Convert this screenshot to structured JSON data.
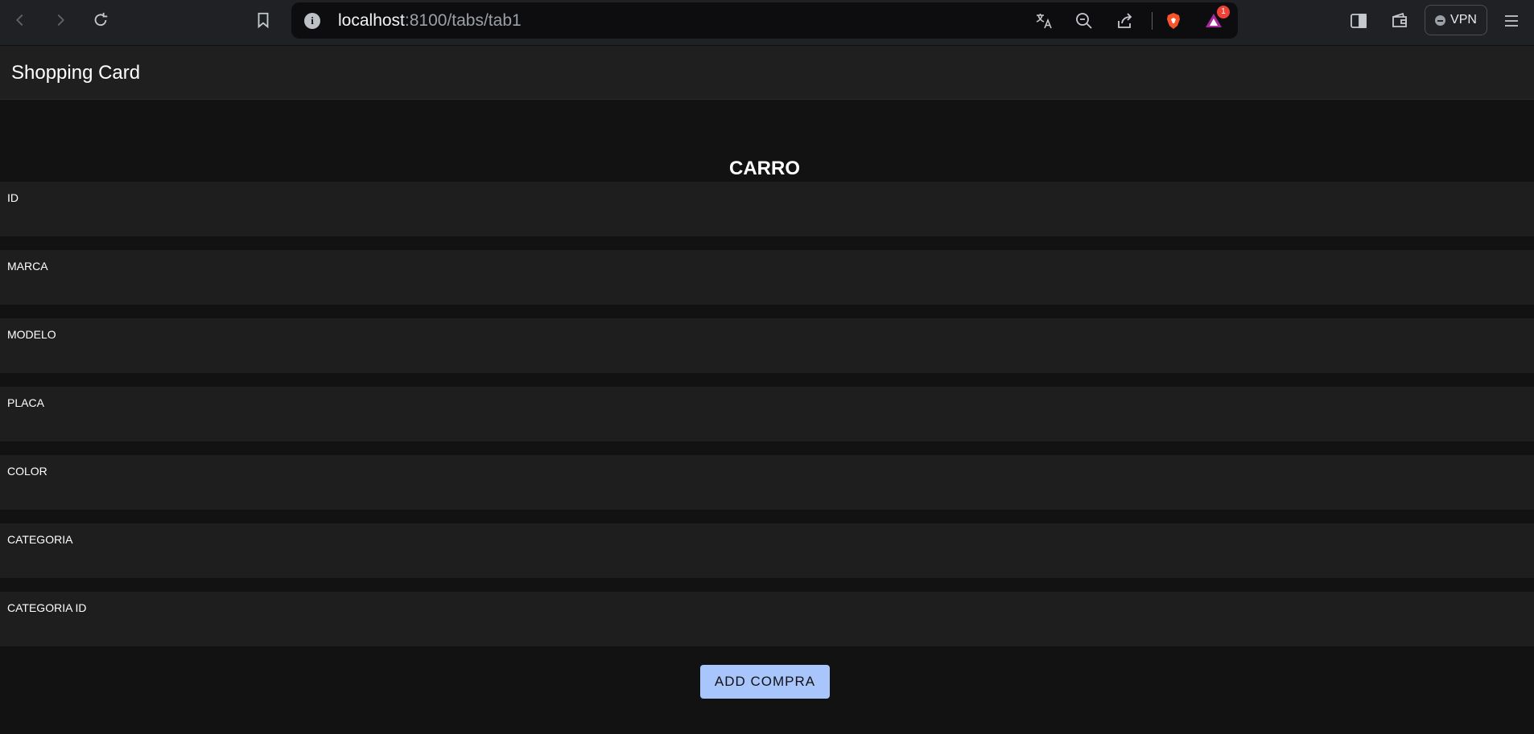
{
  "browser": {
    "url_host": "localhost",
    "url_rest": ":8100/tabs/tab1",
    "notification_count": "1",
    "vpn_label": "VPN",
    "icons": [
      "back-icon",
      "forward-icon",
      "reload-icon",
      "bookmark-icon",
      "info-icon",
      "translate-icon",
      "zoom-out-icon",
      "share-icon",
      "brave-shield-icon",
      "brave-rewards-icon",
      "sidebar-icon",
      "wallet-icon",
      "menu-icon"
    ]
  },
  "app": {
    "title": "Shopping Card",
    "heading": "CARRO",
    "fields": [
      {
        "label": "ID",
        "value": ""
      },
      {
        "label": "MARCA",
        "value": ""
      },
      {
        "label": "MODELO",
        "value": ""
      },
      {
        "label": "PLACA",
        "value": ""
      },
      {
        "label": "COLOR",
        "value": ""
      },
      {
        "label": "CATEGORIA",
        "value": ""
      },
      {
        "label": "CATEGORIA ID",
        "value": ""
      }
    ],
    "submit_label": "ADD COMPRA"
  },
  "colors": {
    "background": "#121212",
    "toolbar": "#1f1f1f",
    "field_background": "#1e1e1e",
    "button": "#a8c6fb",
    "browser_chrome": "#202124"
  }
}
